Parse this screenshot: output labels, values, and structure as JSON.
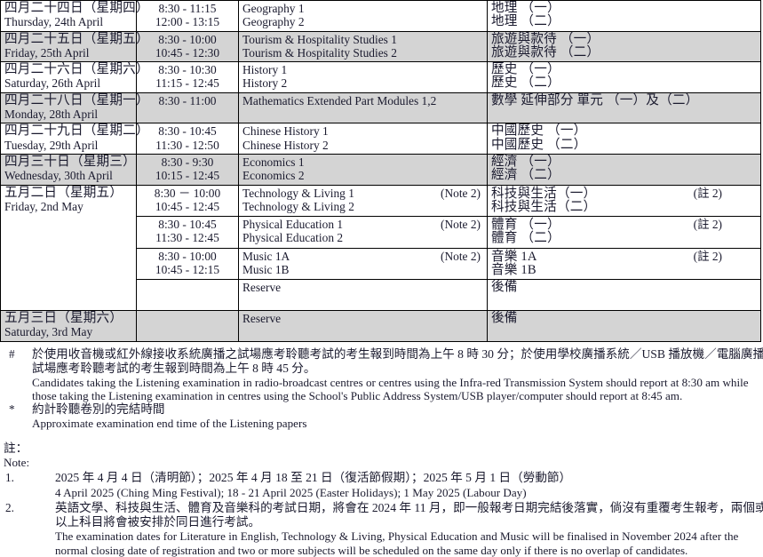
{
  "document": {
    "type": "examination-timetable",
    "language": "bilingual-zh-en"
  },
  "table": {
    "rows": [
      {
        "shaded": false,
        "thick_top": false,
        "date_zh": "四月二十四日（星期四）",
        "date_en": "Thursday, 24th April",
        "times": [
          "8:30 - 11:15",
          "12:00 - 13:15"
        ],
        "subjects_en": [
          "Geography 1",
          "Geography 2"
        ],
        "notes_en": [
          "",
          ""
        ],
        "subjects_zh": [
          "地理 （一）",
          "地理 （二）"
        ],
        "notes_zh": [
          "",
          ""
        ]
      },
      {
        "shaded": true,
        "thick_top": false,
        "date_zh": "四月二十五日（星期五）",
        "date_en": "Friday, 25th April",
        "times": [
          "8:30 - 10:00",
          "10:45 - 12:30"
        ],
        "subjects_en": [
          "Tourism & Hospitality Studies 1",
          "Tourism & Hospitality Studies 2"
        ],
        "notes_en": [
          "",
          ""
        ],
        "subjects_zh": [
          "旅遊與款待 （一）",
          "旅遊與款待 （二）"
        ],
        "notes_zh": [
          "",
          ""
        ]
      },
      {
        "shaded": false,
        "thick_top": false,
        "date_zh": "四月二十六日（星期六）",
        "date_en": "Saturday, 26th April",
        "times": [
          "8:30 - 10:30",
          "11:15 - 12:45"
        ],
        "subjects_en": [
          "History 1",
          "History 2"
        ],
        "notes_en": [
          "",
          ""
        ],
        "subjects_zh": [
          "歷史 （一）",
          "歷史 （二）"
        ],
        "notes_zh": [
          "",
          ""
        ]
      },
      {
        "shaded": true,
        "thick_top": true,
        "date_zh": "四月二十八日（星期一）",
        "date_en": "Monday, 28th April",
        "times": [
          "8:30 - 11:00",
          ""
        ],
        "subjects_en": [
          "Mathematics Extended Part Modules 1,2",
          ""
        ],
        "notes_en": [
          "",
          ""
        ],
        "subjects_zh": [
          "數學 延伸部分 單元 （一）及（二）",
          ""
        ],
        "notes_zh": [
          "",
          ""
        ]
      },
      {
        "shaded": false,
        "thick_top": false,
        "date_zh": "四月二十九日（星期二）",
        "date_en": "Tuesday, 29th April",
        "times": [
          "8:30 - 10:45",
          "11:30 - 12:50"
        ],
        "subjects_en": [
          "Chinese History 1",
          "Chinese History 2"
        ],
        "notes_en": [
          "",
          ""
        ],
        "subjects_zh": [
          "中國歷史 （一）",
          "中國歷史 （二）"
        ],
        "notes_zh": [
          "",
          ""
        ]
      },
      {
        "shaded": true,
        "thick_top": false,
        "date_zh": "四月三十日（星期三）",
        "date_en": "Wednesday, 30th April",
        "times": [
          "8:30 - 9:30",
          "10:15 - 12:45"
        ],
        "subjects_en": [
          "Economics 1",
          "Economics 2"
        ],
        "notes_en": [
          "",
          ""
        ],
        "subjects_zh": [
          "經濟 （一）",
          "經濟 （二）"
        ],
        "notes_zh": [
          "",
          ""
        ]
      },
      {
        "shaded": false,
        "thick_top": false,
        "date_zh": "五月二日（星期五）",
        "date_en": "Friday, 2nd May",
        "times": [
          "8:30 － 10:00",
          "10:45 - 12:45"
        ],
        "subjects_en": [
          "Technology & Living 1",
          "Technology & Living 2"
        ],
        "notes_en": [
          "(Note 2)",
          ""
        ],
        "subjects_zh": [
          "科技與生活（一）",
          "科技與生活（二）"
        ],
        "notes_zh": [
          "(註 2)",
          ""
        ],
        "date_rowspan": 4
      },
      {
        "shaded": false,
        "thick_top": false,
        "continuation": true,
        "times": [
          "8:30 - 10:45",
          "11:30 - 12:45"
        ],
        "subjects_en": [
          "Physical Education 1",
          "Physical Education 2"
        ],
        "notes_en": [
          "(Note 2)",
          ""
        ],
        "subjects_zh": [
          "體育 （一）",
          "體育 （二）"
        ],
        "notes_zh": [
          "(註 2)",
          ""
        ]
      },
      {
        "shaded": false,
        "thick_top": false,
        "continuation": true,
        "times": [
          "8:30 - 10:00",
          "10:45 - 12:15"
        ],
        "subjects_en": [
          "Music 1A",
          "Music 1B"
        ],
        "notes_en": [
          "(Note 2)",
          ""
        ],
        "subjects_zh": [
          "音樂 1A",
          "音樂 1B"
        ],
        "notes_zh": [
          "(註 2)",
          ""
        ]
      },
      {
        "shaded": false,
        "thick_top": false,
        "continuation": true,
        "times": [
          "",
          ""
        ],
        "subjects_en": [
          "Reserve",
          ""
        ],
        "notes_en": [
          "",
          ""
        ],
        "subjects_zh": [
          "後備",
          ""
        ],
        "notes_zh": [
          "",
          ""
        ]
      },
      {
        "shaded": true,
        "thick_top": false,
        "date_zh": "五月三日（星期六）",
        "date_en": "Saturday, 3rd May",
        "times": [
          "",
          ""
        ],
        "subjects_en": [
          "Reserve",
          ""
        ],
        "notes_en": [
          "",
          ""
        ],
        "subjects_zh": [
          "後備",
          ""
        ],
        "notes_zh": [
          "",
          ""
        ]
      }
    ]
  },
  "footnotes": [
    {
      "mark": "#",
      "zh_lines": [
        "於使用收音機或紅外線接收系統廣播之試場應考聆聽考試的考生報到時間為上午 8 時 30 分；於使用學校廣播系統／USB 播放機／電腦廣播之",
        "試場應考聆聽考試的考生報到時間為上午 8 時 45 分。"
      ],
      "en_lines": [
        "Candidates taking the Listening examination in radio-broadcast centres or centres using the Infra-red Transmission System should report at 8:30 am while",
        "those taking the Listening examination in centres using the School's Public Address System/USB player/computer should report at 8:45 am."
      ]
    },
    {
      "mark": "*",
      "zh_lines": [
        "約計聆聽卷別的完結時間"
      ],
      "en_lines": [
        "Approximate examination end time of the Listening papers"
      ]
    }
  ],
  "notes_section": {
    "heading_zh": "註：",
    "heading_en": "Note:",
    "items": [
      {
        "num": "1.",
        "zh_lines": [
          "2025 年 4 月 4 日（清明節）；2025 年 4 月 18 至 21 日（復活節假期）；2025 年 5 月 1 日（勞動節）"
        ],
        "en_lines": [
          "4 April 2025 (Ching Ming Festival); 18 - 21 April 2025 (Easter Holidays); 1 May 2025 (Labour Day)"
        ]
      },
      {
        "num": "2.",
        "zh_lines": [
          "英語文學、科技與生活、體育及音樂科的考試日期，將會在 2024 年 11 月，即一般報考日期完結後落實，倘沒有重覆考生報考，兩個或",
          "以上科目將會被安排於同日進行考試。"
        ],
        "en_lines": [
          "The examination dates for Literature in English, Technology & Living, Physical Education and Music will be finalised in November 2024 after the",
          "normal closing date of registration and two or more subjects will be scheduled on the same day only if there is no overlap of candidates."
        ]
      }
    ]
  },
  "colors": {
    "shaded_row": "#d4d4d4",
    "border": "#000000",
    "text": "#1a1a2e"
  }
}
